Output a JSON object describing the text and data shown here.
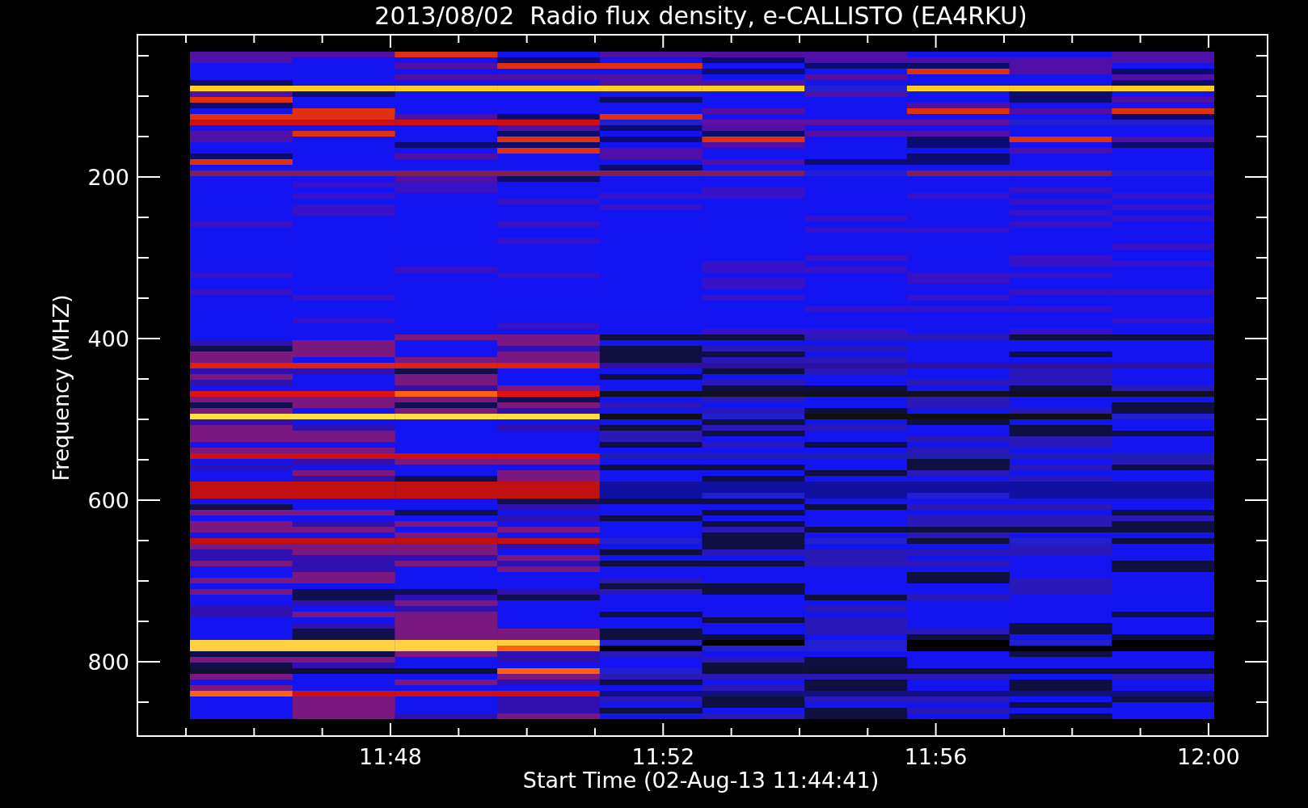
{
  "plot": {
    "title": "2013/08/02  Radio flux density, e-CALLISTO (EA4RKU)",
    "x_axis": {
      "label": "Start Time (02-Aug-13 11:44:41)",
      "ticks": [
        "11:48",
        "11:52",
        "11:56",
        "12:00"
      ]
    },
    "y_axis": {
      "label": "Frequency (MHZ)",
      "ticks": [
        "200",
        "400",
        "600",
        "800"
      ]
    }
  }
}
